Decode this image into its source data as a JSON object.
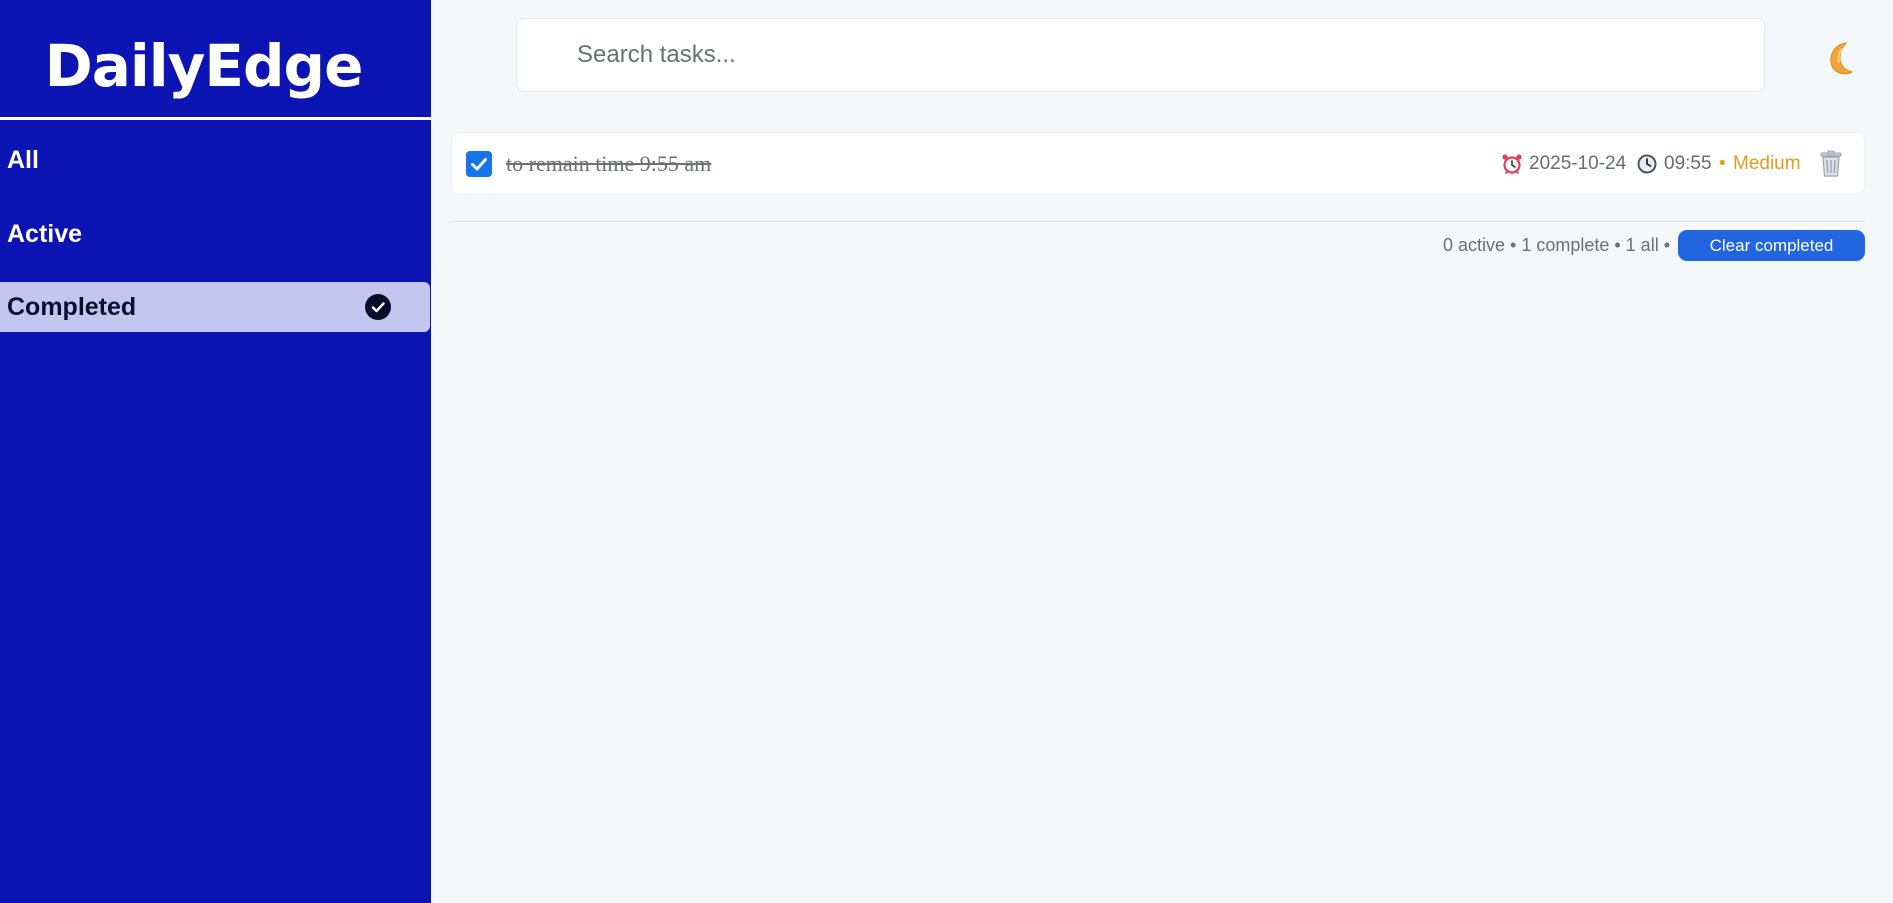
{
  "app": {
    "title": "DailyEdge"
  },
  "sidebar": {
    "items": [
      {
        "label": "All",
        "active": false
      },
      {
        "label": "Active",
        "active": false
      },
      {
        "label": "Completed",
        "active": true,
        "icon": "check-circle-icon"
      }
    ]
  },
  "search": {
    "placeholder": "Search tasks...",
    "value": ""
  },
  "header": {
    "theme_icon": "moon-icon"
  },
  "tasks": [
    {
      "text": "to remain time 9:55 am",
      "completed": true,
      "date": "2025-10-24",
      "time": "09:55",
      "priority": "Medium",
      "priority_bullet": "•",
      "date_icon": "alarm-clock-icon",
      "time_icon": "clock-icon",
      "delete_icon": "trash-icon"
    }
  ],
  "footer": {
    "stats": "0 active • 1 complete • 1 all •",
    "clear_label": "Clear completed"
  },
  "colors": {
    "sidebar_bg": "#0c14b3",
    "active_nav_bg": "#c3c7f0",
    "accent": "#2265e0",
    "checkbox": "#1673e8",
    "priority_medium": "#e89a1a",
    "page_bg": "#f5f8fb"
  }
}
